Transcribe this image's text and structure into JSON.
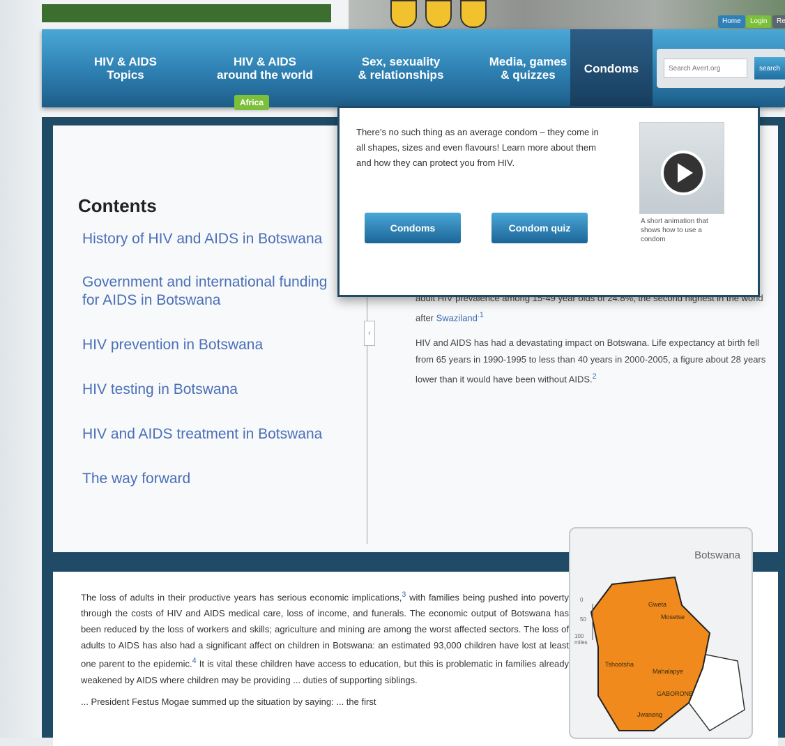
{
  "header": {
    "utility_links": [
      "Home",
      "Login",
      "Register"
    ],
    "colors": {
      "accent_green": "#8cc641",
      "nav_blue": "#2d7fb1",
      "frame_navy": "#1f4b67"
    }
  },
  "nav": {
    "items": [
      {
        "line1": "HIV & AIDS",
        "line2": "Topics"
      },
      {
        "line1": "HIV & AIDS",
        "line2": "around the world"
      },
      {
        "line1": "Sex, sexuality",
        "line2": "& relationships"
      },
      {
        "line1": "Media, games",
        "line2": "& quizzes"
      },
      {
        "line1": "Condoms",
        "line2": ""
      }
    ],
    "badge": "Africa"
  },
  "search": {
    "placeholder": "Search Avert.org",
    "button": "search"
  },
  "dropdown": {
    "text": "There's no such thing as an average condom – they come in all shapes, sizes and even flavours! Learn more about them and how they can protect you from HIV.",
    "button_condoms": "Condoms",
    "button_quiz": "Condom quiz",
    "video_caption": "A short animation that shows how to use a condom"
  },
  "contents": {
    "title": "Contents",
    "items": [
      "History of HIV and AIDS in Botswana",
      "Government and international funding for AIDS in Botswana",
      "HIV prevention in Botswana",
      "HIV testing in Botswana",
      "HIV and AIDS treatment in Botswana",
      "The way forward"
    ]
  },
  "article": {
    "p1_text": "adult HIV prevalence among 15-49 year olds of 24.8%, the second highest in the world after ",
    "p1_link": "Swaziland",
    "p1_ref": ".1",
    "p2_text": "HIV and AIDS has had a devastating impact on Botswana. Life expectancy at birth fell from 65 years in 1990-1995 to less than 40 years in 2000-2005, a figure about 28 years lower than it would have been without AIDS.",
    "p2_ref": "2"
  },
  "lower": {
    "p1": "The loss of adults in their productive years has serious economic implications,",
    "ref3": "3",
    "p1b": " with families being pushed into poverty through the costs of HIV and AIDS medical care, loss of income, and funerals. The economic output of Botswana has been reduced by the loss of workers and skills; agriculture and mining are among the worst affected sectors. The loss of adults to AIDS has also had a significant affect on children in Botswana: an estimated 93,000 children have lost at least one parent to the epidemic.",
    "ref4": "4",
    "p1c": " It is vital these children have access to education, but this is problematic in families already weakened by AIDS where children may be providing ... duties of supporting siblings.",
    "p2": "... President Festus Mogae summed up the situation by saying: ... the first"
  },
  "map": {
    "title": "Botswana",
    "places": [
      "Gweta",
      "Mosetse",
      "Tshootsha",
      "Mahalapye",
      "GABORONE",
      "Jwaneng"
    ],
    "legend": [
      "0",
      "50",
      "100 miles"
    ],
    "country_color": "#f08a1c"
  }
}
